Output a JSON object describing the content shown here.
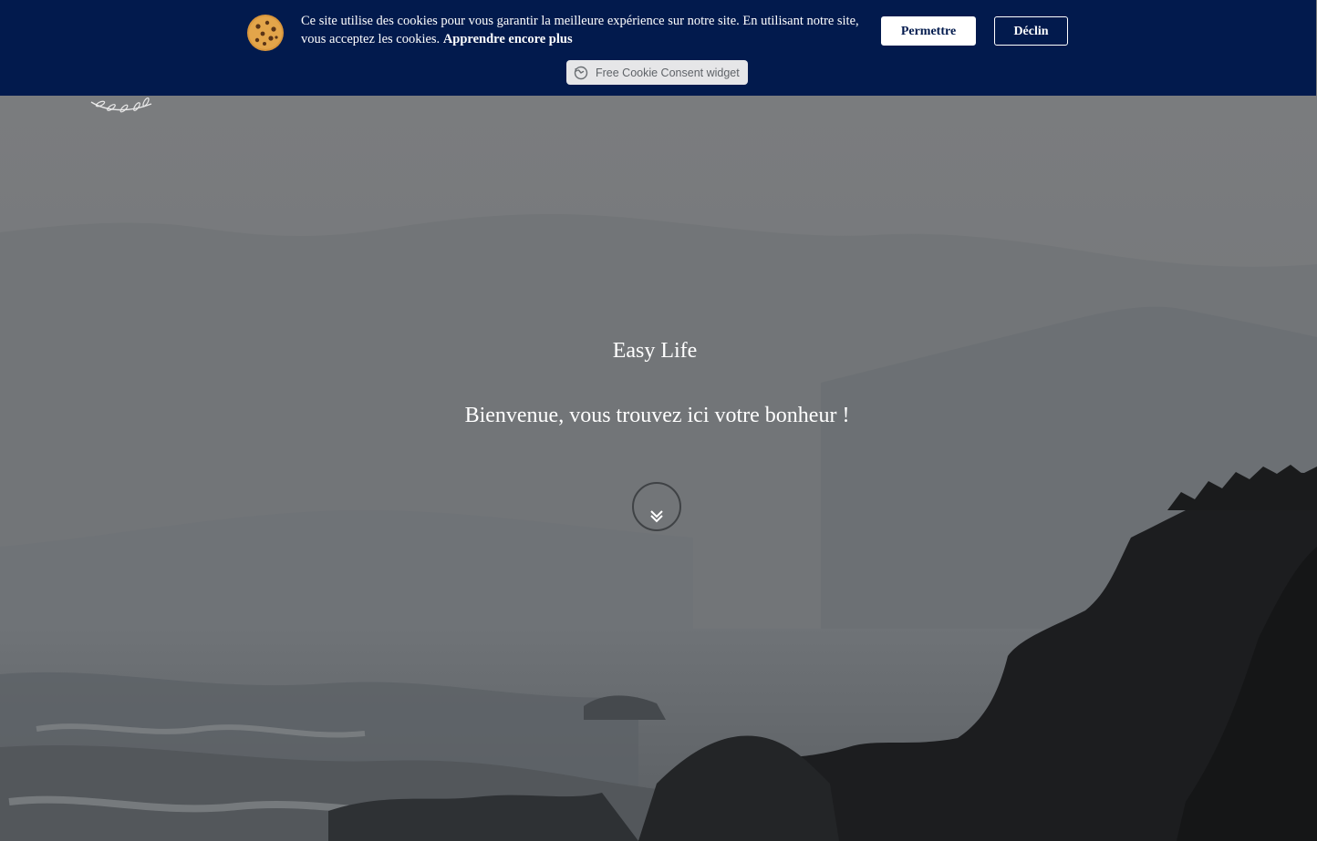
{
  "cookie_banner": {
    "message": "Ce site utilise des cookies pour vous garantir la meilleure expérience sur notre site. En utilisant notre site, vous acceptez les cookies.",
    "learn_more": "Apprendre encore plus",
    "allow_label": "Permettre",
    "decline_label": "Déclin",
    "widget_label": "Free Cookie Consent widget",
    "background_color": "#021a4d",
    "icons": {
      "cookie": "cookie-icon",
      "widget": "refresh-icon"
    }
  },
  "hero": {
    "title": "Easy Life",
    "tagline": "Bienvenue, vous trouvez ici votre bonheur !",
    "scroll_icon": "double-chevron-down-icon"
  },
  "logo": {
    "icon": "laurel-branch-icon"
  }
}
